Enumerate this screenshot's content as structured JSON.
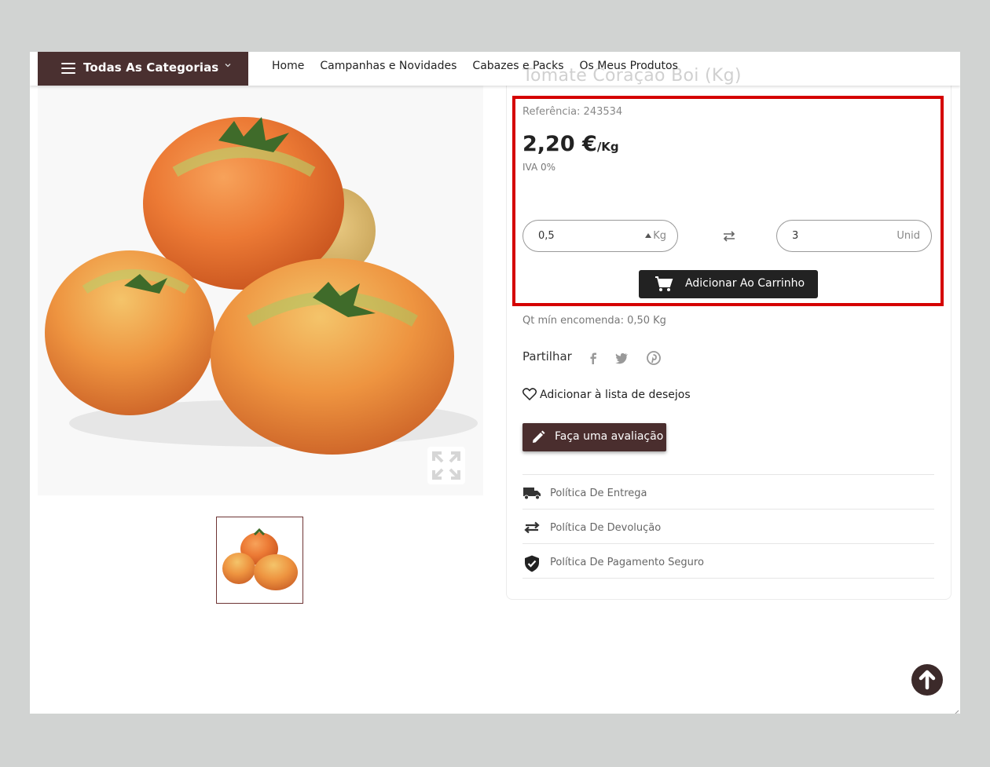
{
  "nav": {
    "categories_label": "Todas As Categorias",
    "links": [
      "Home",
      "Campanhas e Novidades",
      "Cabazes e Packs",
      "Os Meus Produtos"
    ]
  },
  "product": {
    "title": "Tomate Coração Boi (Kg)",
    "reference": "Referência: 243534",
    "price": "2,20 €",
    "price_unit": "/Kg",
    "vat": "IVA 0%",
    "qty_weight_value": "0,5",
    "qty_weight_unit": "Kg",
    "qty_units_value": "3",
    "qty_units_unit": "Unid",
    "add_to_cart_label": "Adicionar Ao Carrinho",
    "min_order": "Qt mín encomenda: 0,50 Kg",
    "share_label": "Partilhar",
    "wishlist_label": "Adicionar à lista de desejos",
    "review_label": "Faça uma avaliação"
  },
  "policies": [
    {
      "label": "Política De Entrega",
      "icon": "truck-icon"
    },
    {
      "label": "Política De Devolução",
      "icon": "swap-arrows-icon"
    },
    {
      "label": "Política De Pagamento Seguro",
      "icon": "shield-check-icon"
    }
  ],
  "colors": {
    "brand_dark": "#4a3030",
    "highlight": "#d50000",
    "cart_button": "#222222"
  }
}
